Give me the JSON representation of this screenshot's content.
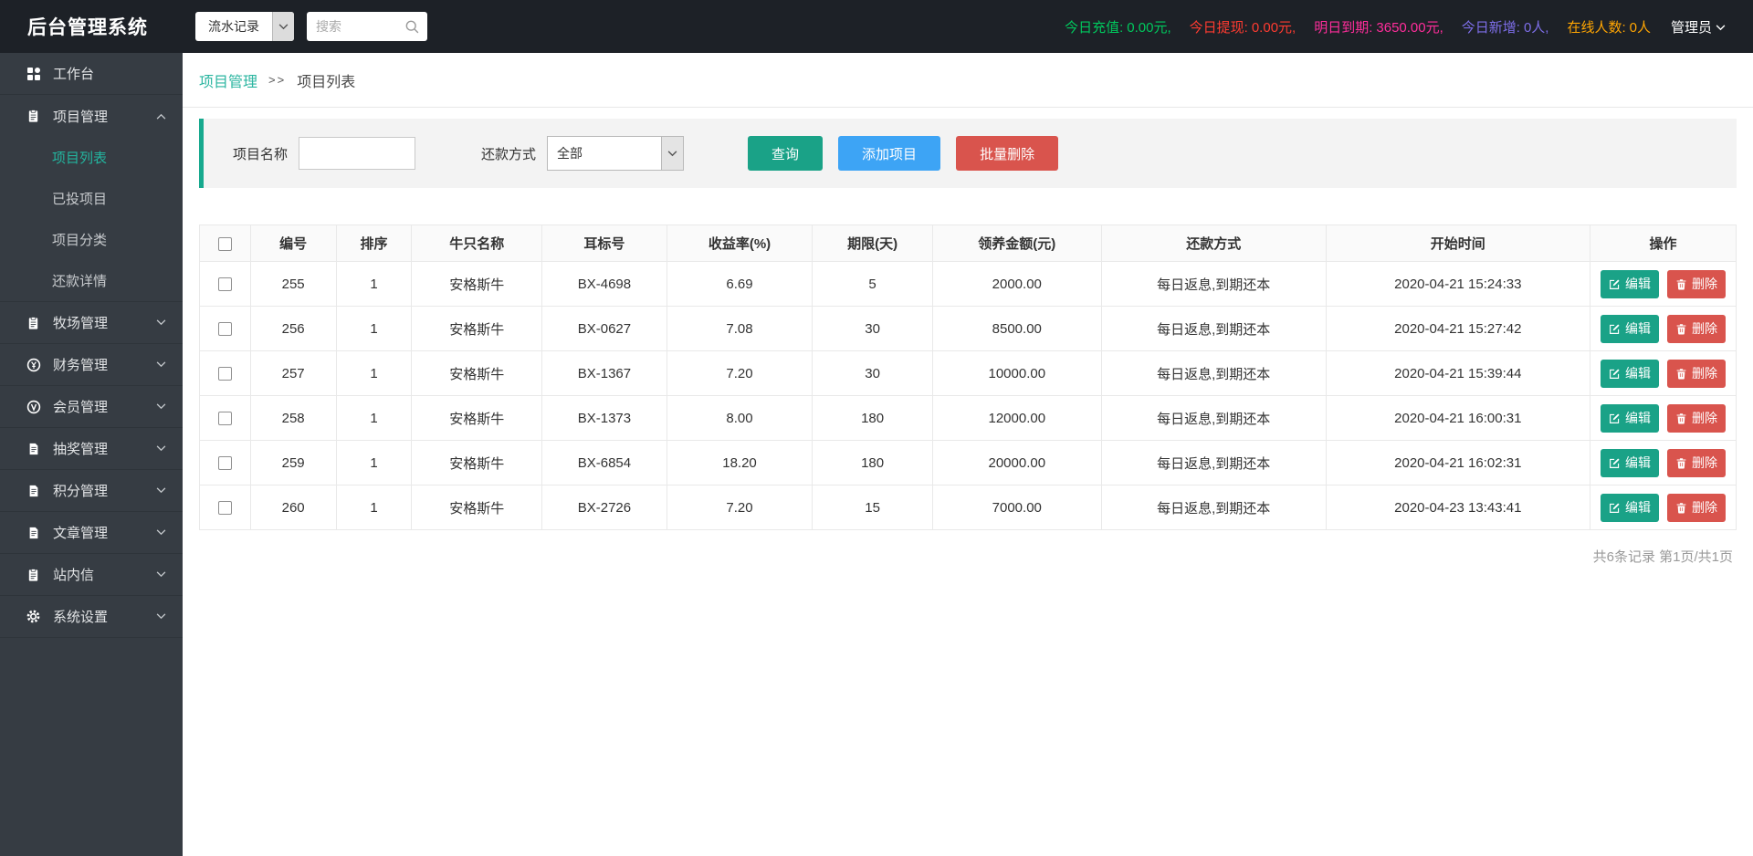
{
  "app": {
    "title": "后台管理系统"
  },
  "topbar": {
    "module_select": {
      "value": "流水记录"
    },
    "search": {
      "placeholder": "搜索"
    },
    "stats": [
      {
        "label": "今日充值:",
        "value": "0.00元,",
        "color": "#00c85d"
      },
      {
        "label": "今日提现:",
        "value": "0.00元,",
        "color": "#ff3b30"
      },
      {
        "label": "明日到期:",
        "value": "3650.00元,",
        "color": "#ff2d9b"
      },
      {
        "label": "今日新增:",
        "value": "0人,",
        "color": "#7d6ee8"
      },
      {
        "label": "在线人数:",
        "value": "0人",
        "color": "#ffa502"
      }
    ],
    "user": {
      "name": "管理员"
    }
  },
  "sidebar": {
    "items": [
      {
        "label": "工作台",
        "icon": "dashboard-icon"
      },
      {
        "label": "项目管理",
        "icon": "clipboard-icon",
        "expanded": true,
        "children": [
          {
            "label": "项目列表",
            "active": true
          },
          {
            "label": "已投项目"
          },
          {
            "label": "项目分类"
          },
          {
            "label": "还款详情"
          }
        ]
      },
      {
        "label": "牧场管理",
        "icon": "clipboard-icon"
      },
      {
        "label": "财务管理",
        "icon": "yuan-circle-icon"
      },
      {
        "label": "会员管理",
        "icon": "member-circle-icon"
      },
      {
        "label": "抽奖管理",
        "icon": "document-icon"
      },
      {
        "label": "积分管理",
        "icon": "document-icon"
      },
      {
        "label": "文章管理",
        "icon": "document-icon"
      },
      {
        "label": "站内信",
        "icon": "clipboard-icon"
      },
      {
        "label": "系统设置",
        "icon": "gear-icon"
      }
    ]
  },
  "breadcrumb": {
    "section": "项目管理",
    "separator": ">>",
    "page": "项目列表"
  },
  "filter": {
    "name_label": "项目名称",
    "name_value": "",
    "method_label": "还款方式",
    "method_selected": "全部",
    "query_button": "查询",
    "add_button": "添加项目",
    "batch_delete_button": "批量删除"
  },
  "table": {
    "headers": [
      "编号",
      "排序",
      "牛只名称",
      "耳标号",
      "收益率(%)",
      "期限(天)",
      "领养金额(元)",
      "还款方式",
      "开始时间",
      "操作"
    ],
    "edit_label": "编辑",
    "delete_label": "删除",
    "rows": [
      {
        "id": "255",
        "sort": "1",
        "name": "安格斯牛",
        "tag": "BX-4698",
        "rate": "6.69",
        "days": "5",
        "amount": "2000.00",
        "method": "每日返息,到期还本",
        "time": "2020-04-21 15:24:33"
      },
      {
        "id": "256",
        "sort": "1",
        "name": "安格斯牛",
        "tag": "BX-0627",
        "rate": "7.08",
        "days": "30",
        "amount": "8500.00",
        "method": "每日返息,到期还本",
        "time": "2020-04-21 15:27:42"
      },
      {
        "id": "257",
        "sort": "1",
        "name": "安格斯牛",
        "tag": "BX-1367",
        "rate": "7.20",
        "days": "30",
        "amount": "10000.00",
        "method": "每日返息,到期还本",
        "time": "2020-04-21 15:39:44"
      },
      {
        "id": "258",
        "sort": "1",
        "name": "安格斯牛",
        "tag": "BX-1373",
        "rate": "8.00",
        "days": "180",
        "amount": "12000.00",
        "method": "每日返息,到期还本",
        "time": "2020-04-21 16:00:31"
      },
      {
        "id": "259",
        "sort": "1",
        "name": "安格斯牛",
        "tag": "BX-6854",
        "rate": "18.20",
        "days": "180",
        "amount": "20000.00",
        "method": "每日返息,到期还本",
        "time": "2020-04-21 16:02:31"
      },
      {
        "id": "260",
        "sort": "1",
        "name": "安格斯牛",
        "tag": "BX-2726",
        "rate": "7.20",
        "days": "15",
        "amount": "7000.00",
        "method": "每日返息,到期还本",
        "time": "2020-04-23 13:43:41"
      }
    ]
  },
  "pagination": {
    "summary": "共6条记录 第1页/共1页"
  },
  "colors": {
    "accent_teal": "#1aa287",
    "button_blue": "#3da4f5",
    "button_red": "#d9544d",
    "active_menu": "#23b59f",
    "topbar_bg": "#1d2127",
    "sidebar_bg": "#363c43"
  }
}
